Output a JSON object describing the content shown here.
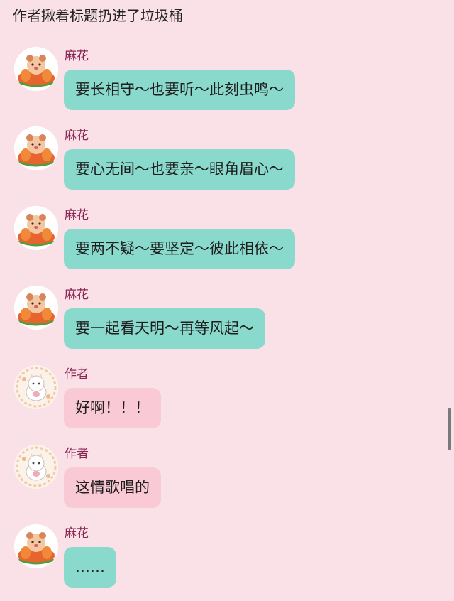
{
  "title": "作者揪着标题扔进了垃圾桶",
  "messages": [
    {
      "sender": "麻花",
      "text": "要长相守～也要听～此刻虫鸣～",
      "avatar_icon": "shiba-avatar-icon",
      "bubble_color": "#8ad9cd"
    },
    {
      "sender": "麻花",
      "text": "要心无间～也要亲～眼角眉心～",
      "avatar_icon": "shiba-avatar-icon",
      "bubble_color": "#8ad9cd"
    },
    {
      "sender": "麻花",
      "text": "要两不疑～要坚定～彼此相依～",
      "avatar_icon": "shiba-avatar-icon",
      "bubble_color": "#8ad9cd"
    },
    {
      "sender": "麻花",
      "text": "要一起看天明～再等风起～",
      "avatar_icon": "shiba-avatar-icon",
      "bubble_color": "#8ad9cd"
    },
    {
      "sender": "作者",
      "text": "好啊！！！",
      "avatar_icon": "cat-avatar-icon",
      "bubble_color": "#fac9d6"
    },
    {
      "sender": "作者",
      "text": "这情歌唱的",
      "avatar_icon": "cat-avatar-icon",
      "bubble_color": "#fac9d6"
    },
    {
      "sender": "麻花",
      "text": "……",
      "avatar_icon": "shiba-avatar-icon",
      "bubble_color": "#8ad9cd"
    }
  ],
  "colors": {
    "background": "#f9e1e7",
    "sender_name": "#8a2652",
    "teal_bubble": "#8ad9cd",
    "pink_bubble": "#fac9d6"
  }
}
